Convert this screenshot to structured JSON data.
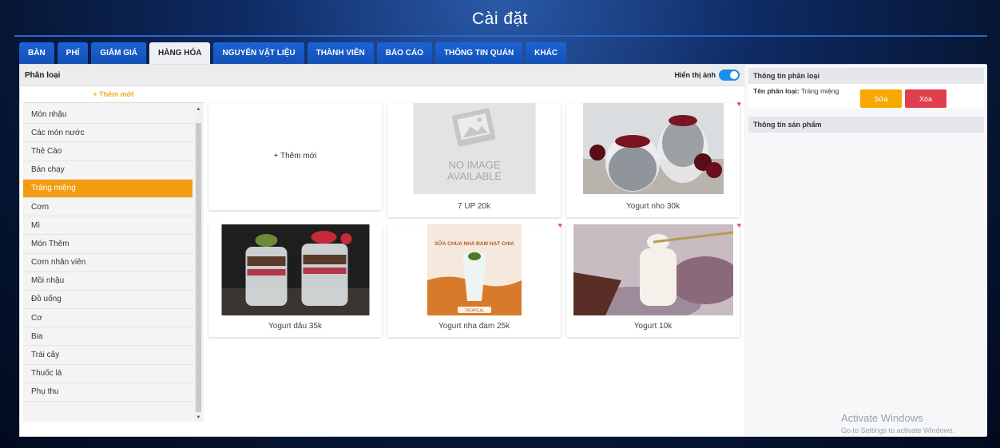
{
  "window": {
    "title": "Cài đặt"
  },
  "tabs": [
    {
      "label": "BÀN",
      "active": false
    },
    {
      "label": "PHÍ",
      "active": false
    },
    {
      "label": "GIẢM GIÁ",
      "active": false
    },
    {
      "label": "HÀNG HÓA",
      "active": true
    },
    {
      "label": "NGUYÊN VẬT LIỆU",
      "active": false
    },
    {
      "label": "THÀNH VIÊN",
      "active": false
    },
    {
      "label": "BÁO CÁO",
      "active": false
    },
    {
      "label": "THÔNG TIN QUÁN",
      "active": false
    },
    {
      "label": "KHÁC",
      "active": false
    }
  ],
  "left": {
    "header": "Phân loại",
    "show_image_label": "Hiển thị ảnh",
    "show_image_on": true,
    "add_category": "+ Thêm mới"
  },
  "categories": [
    "Món nhậu",
    "Các món nước",
    "Thẻ Cào",
    "Bán chạy",
    "Tráng miệng",
    "Cơm",
    "Mì",
    "Món Thêm",
    "Cơm nhân viên",
    "Mồi nhậu",
    "Đồ uống",
    "Cơ",
    "Bia",
    "Trái cây",
    "Thuốc lá",
    "Phụ thu"
  ],
  "active_category": "Tráng miệng",
  "products": {
    "add_new": "+ Thêm mới",
    "items": [
      {
        "name": "7 UP 20k",
        "image": "no-image",
        "favorite": false,
        "no_image_text": [
          "NO IMAGE",
          "AVAILABLE"
        ]
      },
      {
        "name": "Yogurt nho 30k",
        "image": "chia-cherry",
        "favorite": true
      },
      {
        "name": "Yogurt dâu 35k",
        "image": "parfait",
        "favorite": false
      },
      {
        "name": "Yogurt nha đam 25k",
        "image": "aloe-poster",
        "favorite": true,
        "poster_text": "SỮA CHUA NHA ĐAM HẠT CHIA",
        "poster_badge": "TROPICAL"
      },
      {
        "name": "Yogurt 10k",
        "image": "yogurt-jar",
        "favorite": true
      }
    ]
  },
  "right": {
    "category_info_title": "Thông tin phân loại",
    "category_name_label": "Tên phân loại:",
    "category_name_value": "Tráng miệng",
    "edit_label": "Sửa",
    "delete_label": "Xóa",
    "product_info_title": "Thông tin sản phẩm"
  },
  "watermark": {
    "line1": "Activate Windows",
    "line2": "Go to Settings to activate Windows."
  },
  "colors": {
    "accent": "#1c63d6",
    "active_category": "#f39c12",
    "edit": "#f5a800",
    "delete": "#e23d4d",
    "add": "#f5a623"
  }
}
